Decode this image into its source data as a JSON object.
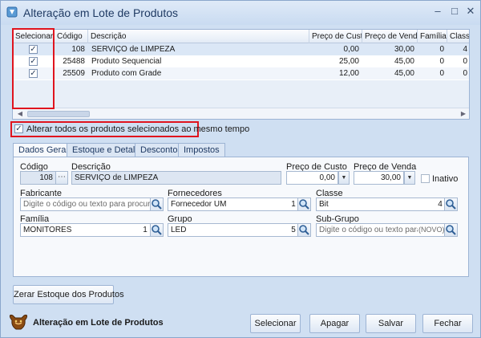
{
  "window": {
    "title": "Alteração em Lote de Produtos"
  },
  "grid": {
    "columns": [
      "Selecionar",
      "Código",
      "Descrição",
      "Preço de Custo",
      "Preço de Venda",
      "Família",
      "Classe"
    ],
    "rows": [
      {
        "selected": true,
        "codigo": "108",
        "descricao": "SERVIÇO de LIMPEZA",
        "custo": "0,00",
        "venda": "30,00",
        "familia": "0",
        "classe": "4"
      },
      {
        "selected": true,
        "codigo": "25488",
        "descricao": "Produto Sequencial",
        "custo": "25,00",
        "venda": "45,00",
        "familia": "0",
        "classe": "0"
      },
      {
        "selected": true,
        "codigo": "25509",
        "descricao": "Produto com Grade",
        "custo": "12,00",
        "venda": "45,00",
        "familia": "0",
        "classe": "0"
      }
    ]
  },
  "alter_all": {
    "checked": true,
    "label": "Alterar todos os produtos selecionados ao mesmo tempo"
  },
  "tabs": [
    {
      "label": "Dados Gerais",
      "active": true
    },
    {
      "label": "Estoque e Detalhes",
      "active": false
    },
    {
      "label": "Descontos",
      "active": false
    },
    {
      "label": "Impostos",
      "active": false
    }
  ],
  "form": {
    "codigo": {
      "label": "Código",
      "value": "108"
    },
    "descricao": {
      "label": "Descrição",
      "value": "SERVIÇO de LIMPEZA"
    },
    "preco_custo": {
      "label": "Preço de Custo",
      "value": "0,00"
    },
    "preco_venda": {
      "label": "Preço de Venda",
      "value": "30,00"
    },
    "inativo": {
      "label": "Inativo",
      "checked": false
    },
    "fabricante": {
      "label": "Fabricante",
      "placeholder": "Digite o código ou texto para procura"
    },
    "fornecedores": {
      "label": "Fornecedores",
      "value": "Fornecedor UM",
      "count": "1"
    },
    "classe": {
      "label": "Classe",
      "value": "Bit",
      "count": "4"
    },
    "familia": {
      "label": "Família",
      "value": "MONITORES",
      "count": "1"
    },
    "grupo": {
      "label": "Grupo",
      "value": "LED",
      "count": "5"
    },
    "subgrupo": {
      "label": "Sub-Grupo",
      "placeholder": "Digite o código ou texto para proc",
      "tag": "(NOVO)"
    }
  },
  "zerar_button": "Zerar Estoque dos Produtos",
  "footer": {
    "title": "Alteração em Lote de Produtos",
    "buttons": {
      "selecionar": "Selecionar",
      "apagar": "Apagar",
      "salvar": "Salvar",
      "fechar": "Fechar"
    }
  },
  "icons": {
    "app": "app-window-icon",
    "search": "magnifier-icon",
    "footer": "bull-logo-icon",
    "minimize": "minimize-icon",
    "maximize": "maximize-icon",
    "close": "close-icon"
  },
  "colors": {
    "highlight_border": "#e0141e",
    "window_bg": "#cfdff2",
    "title_text": "#1f3a63"
  }
}
